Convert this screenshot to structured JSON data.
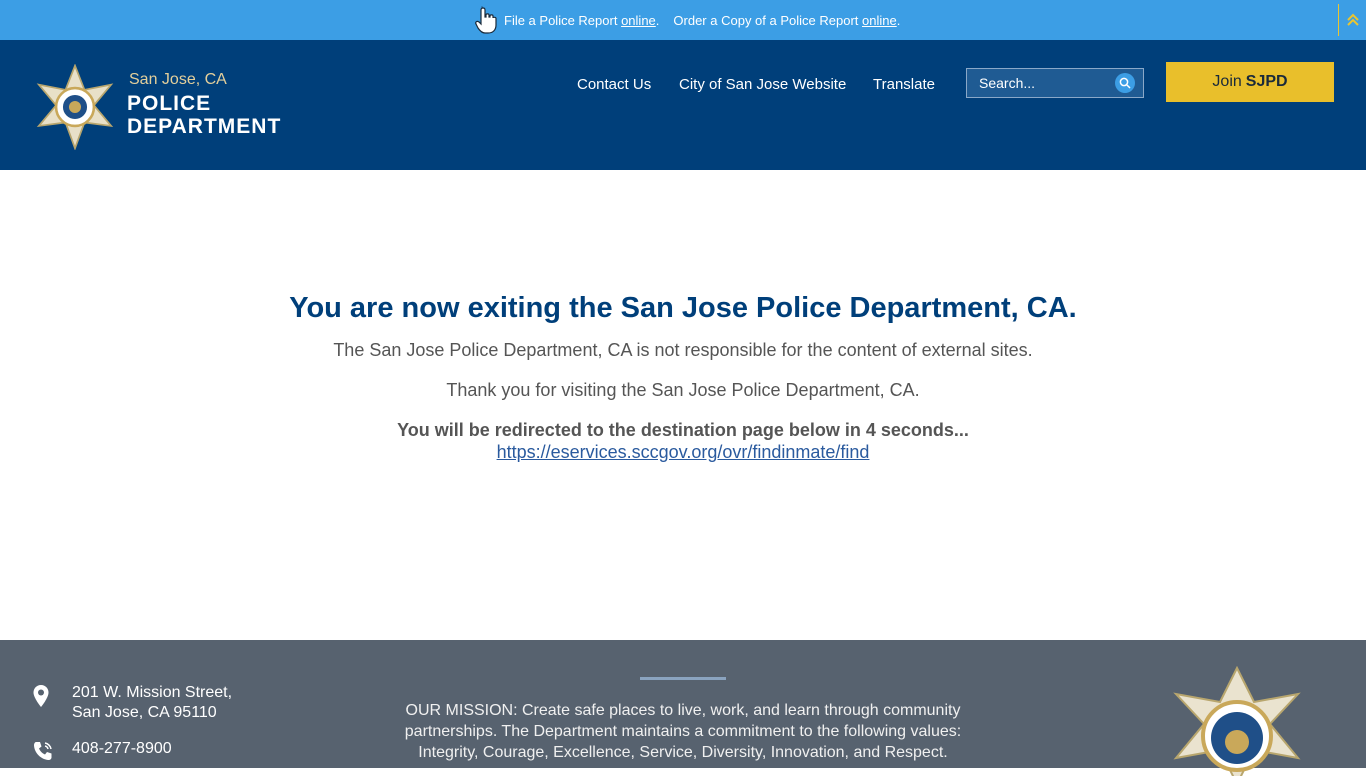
{
  "alert": {
    "text1": "File a Police Report",
    "link1": "online",
    "end1": ".",
    "text2": "Order a Copy of a Police Report",
    "link2": "online",
    "end2": "."
  },
  "header": {
    "logo": {
      "city": "San Jose, CA",
      "line1": "POLICE",
      "line2": "DEPARTMENT"
    },
    "nav": [
      "Contact Us",
      "City of San Jose Website",
      "Translate"
    ],
    "search": {
      "placeholder": "Search..."
    },
    "join": {
      "prefix": "Join",
      "bold": "SJPD"
    }
  },
  "main": {
    "title": "You are now exiting the San Jose Police Department, CA.",
    "disclaimer": "The San Jose Police Department, CA is not responsible for the content of external sites.",
    "thanks": "Thank you for visiting the San Jose Police Department, CA.",
    "redirect": "You will be redirected to the destination page below in 4 seconds...",
    "url": "https://eservices.sccgov.org/ovr/findinmate/find"
  },
  "footer": {
    "address_line1": "201 W. Mission Street,",
    "address_line2": "San Jose, CA 95110",
    "phone": "408-277-8900",
    "mission": "OUR MISSION: Create safe places to live, work, and learn through community partnerships. The Department maintains a commitment to the following values: Integrity, Courage, Excellence, Service, Diversity, Innovation, and Respect."
  },
  "colors": {
    "alert_bar": "#3c9ee5",
    "header": "#003f7a",
    "join_button": "#e9bf2b",
    "title": "#003f7a",
    "footer": "#57626f"
  }
}
